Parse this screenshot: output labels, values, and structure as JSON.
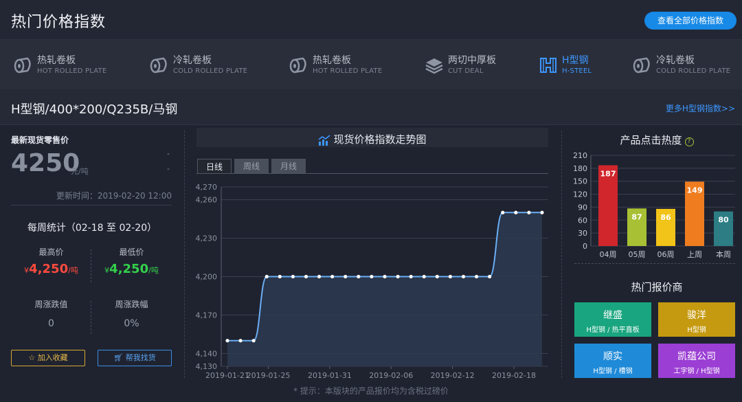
{
  "header": {
    "title": "热门价格指数",
    "view_all": "查看全部价格指数"
  },
  "tabs": [
    {
      "cn": "热轧卷板",
      "en": "HOT ROLLED PLATE",
      "icon": "coil-icon",
      "active": false
    },
    {
      "cn": "冷轧卷板",
      "en": "COLD ROLLED PLATE",
      "icon": "coil-icon",
      "active": false
    },
    {
      "cn": "热轧卷板",
      "en": "HOT ROLLED PLATE",
      "icon": "coil-icon",
      "active": false
    },
    {
      "cn": "两切中厚板",
      "en": "CUT DEAL",
      "icon": "plate-stack-icon",
      "active": false
    },
    {
      "cn": "H型钢",
      "en": "H-STEEL",
      "icon": "h-beam-icon",
      "active": true
    },
    {
      "cn": "冷轧卷板",
      "en": "COLD ROLLED PLATE",
      "icon": "coil-icon",
      "active": false
    }
  ],
  "product": {
    "title": "H型钢/400*200/Q235B/马钢",
    "more_link": "更多H型钢指数>>"
  },
  "retail": {
    "label": "最新现货零售价",
    "price": "4250",
    "unit": "元/吨",
    "change_value": "-",
    "change_pct": "-",
    "update_time": "更新时间：2019-02-20 12:00"
  },
  "weekly": {
    "title": "每周统计（02-18 至 02-20）",
    "high_label": "最高价",
    "high_symbol": "¥",
    "high_value": "4,250",
    "high_unit": "/吨",
    "low_label": "最低价",
    "low_symbol": "¥",
    "low_value": "4,250",
    "low_unit": "/吨",
    "change_label": "周涨跌值",
    "change_value": "0",
    "pct_label": "周涨跌幅",
    "pct_value": "0%"
  },
  "buttons": {
    "favorite": "加入收藏",
    "find": "帮我找货"
  },
  "chart_tabs": {
    "title": "现货价格指数走势图",
    "day": "日线",
    "week": "周线",
    "month": "月线"
  },
  "chart_data": [
    {
      "type": "area",
      "title": "现货价格指数走势图",
      "x": [
        "2019-01-21",
        "2019-01-22",
        "2019-01-23",
        "2019-01-24",
        "2019-01-25",
        "2019-01-28",
        "2019-01-29",
        "2019-01-30",
        "2019-01-31",
        "2019-02-01",
        "2019-02-02",
        "2019-02-03",
        "2019-02-04",
        "2019-02-05",
        "2019-02-06",
        "2019-02-07",
        "2019-02-08",
        "2019-02-11",
        "2019-02-12",
        "2019-02-13",
        "2019-02-14",
        "2019-02-15",
        "2019-02-18",
        "2019-02-19",
        "2019-02-20"
      ],
      "y": [
        4150,
        4150,
        4150,
        4200,
        4200,
        4200,
        4200,
        4200,
        4200,
        4200,
        4200,
        4200,
        4200,
        4200,
        4200,
        4200,
        4200,
        4200,
        4200,
        4200,
        4200,
        4250,
        4250,
        4250,
        4250
      ],
      "x_ticks": [
        "2019-01-21",
        "2019-01-25",
        "2019-01-31",
        "2019-02-06",
        "2019-02-12",
        "2019-02-18"
      ],
      "y_ticks": [
        "4,130",
        "4,140",
        "4,170",
        "4,200",
        "4,230",
        "4,260",
        "4,270"
      ],
      "ylim": [
        4130,
        4270
      ],
      "grid": true,
      "color": "#6aaef5"
    },
    {
      "type": "bar",
      "title": "产品点击热度",
      "categories": [
        "04周",
        "05周",
        "06周",
        "上周",
        "本周"
      ],
      "values": [
        187,
        87,
        86,
        149,
        80
      ],
      "colors": [
        "#d0262c",
        "#a8c034",
        "#f2c318",
        "#ef7d20",
        "#2c7d84"
      ],
      "y_ticks": [
        "0",
        "30",
        "60",
        "90",
        "120",
        "150",
        "180",
        "210"
      ],
      "ylim": [
        0,
        210
      ],
      "grid": true
    }
  ],
  "heat": {
    "title": "产品点击热度",
    "help_icon": "?"
  },
  "suppliers": {
    "title": "热门报价商",
    "items": [
      {
        "name": "继盛",
        "types": "H型钢 / 热平直板",
        "color": "#19a57f"
      },
      {
        "name": "骏洋",
        "types": "H型钢",
        "color": "#c59a10"
      },
      {
        "name": "顺实",
        "types": "H型钢 / 槽钢",
        "color": "#1f8ad8"
      },
      {
        "name": "凯蕴公司",
        "types": "工字钢 / H型钢",
        "color": "#9b3fd4"
      }
    ]
  },
  "footer_tip": "* 提示：本版块的产品报价均为含税过磅价"
}
